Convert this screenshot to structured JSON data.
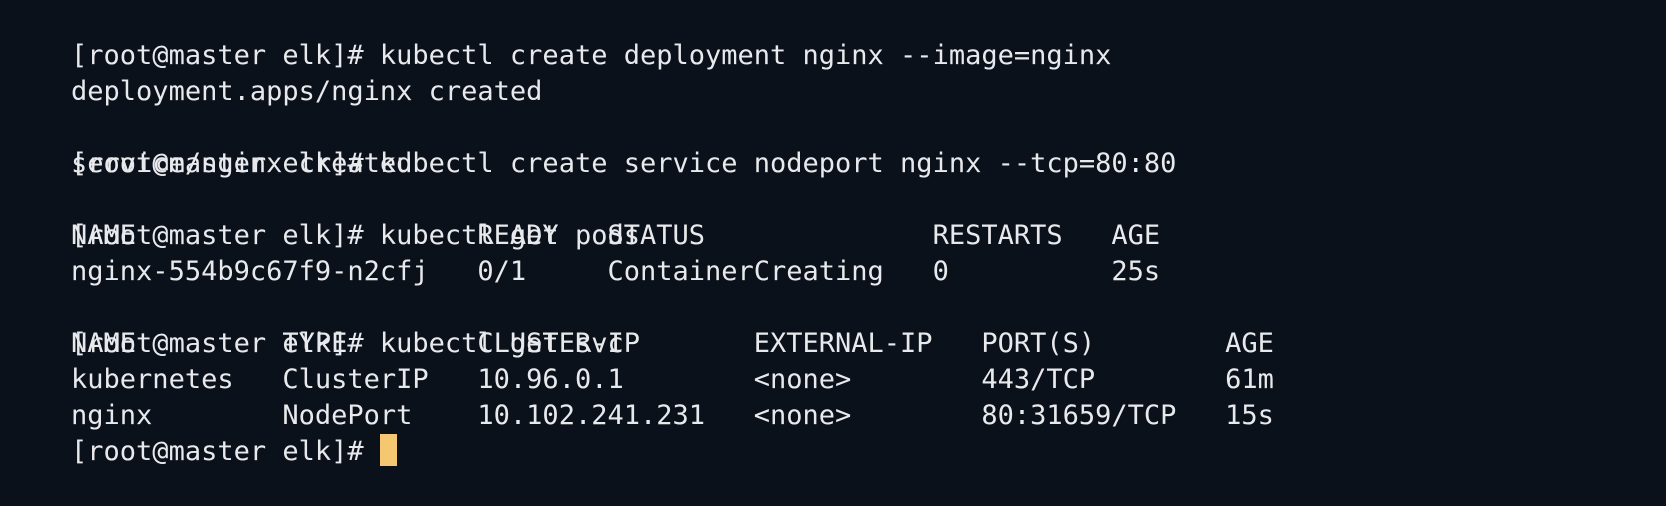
{
  "terminal": {
    "cursor_color": "#f5c771",
    "background_color": "#0b111a",
    "text_color": "#e8e9ec",
    "prompt_mark": "[",
    "lines": [
      "[root@master elk]# kubectl create deployment nginx --image=nginx",
      "deployment.apps/nginx created",
      "[root@master elk]# kubectl create service nodeport nginx --tcp=80:80",
      "service/nginx created",
      "[root@master elk]# kubectl get pods",
      "NAME                     READY   STATUS              RESTARTS   AGE",
      "nginx-554b9c67f9-n2cfj   0/1     ContainerCreating   0          25s",
      "[root@master elk]# kubectl get svc",
      "NAME         TYPE        CLUSTER-IP       EXTERNAL-IP   PORT(S)        AGE",
      "kubernetes   ClusterIP   10.96.0.1        <none>        443/TCP        61m",
      "nginx        NodePort    10.102.241.231   <none>        80:31659/TCP   15s",
      "[root@master elk]# "
    ]
  }
}
